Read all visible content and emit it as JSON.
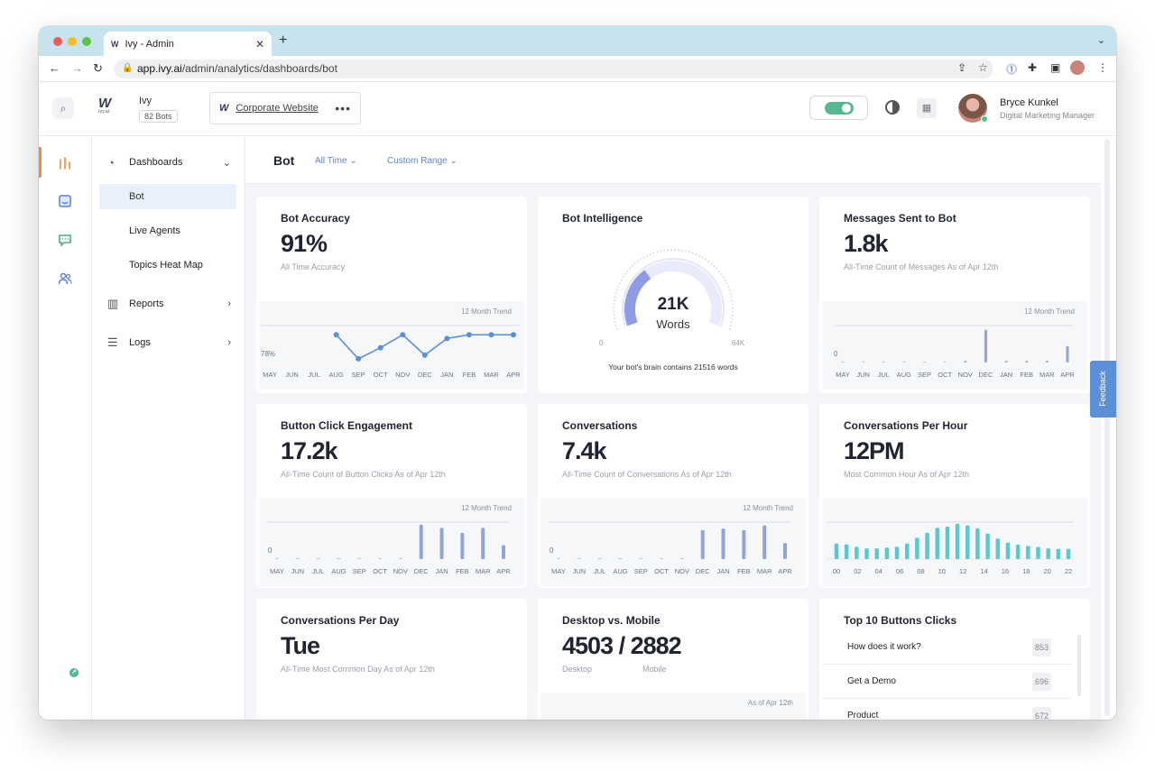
{
  "browser": {
    "tab_title": "Ivy - Admin",
    "favicon": "W",
    "new_tab": "+",
    "url_host": "app.ivy.ai",
    "url_path": "/admin/analytics/dashboards/bot"
  },
  "header": {
    "logo": "W",
    "logo_sub": "ivy.ai",
    "bot_name": "Ivy",
    "bot_count": "82 Bots",
    "site_name": "Corporate Website",
    "site_menu": "•••",
    "user_name": "Bryce Kunkel",
    "user_role": "Digital Marketing Manager"
  },
  "sidebar": {
    "items": [
      {
        "label": "Dashboards",
        "icon": "pie-chart-icon"
      },
      {
        "label": "Bot"
      },
      {
        "label": "Live Agents"
      },
      {
        "label": "Topics Heat Map"
      },
      {
        "label": "Reports",
        "icon": "bar-chart-icon"
      },
      {
        "label": "Logs",
        "icon": "list-icon"
      }
    ]
  },
  "page": {
    "title": "Bot",
    "filter_time": "All Time",
    "filter_range": "Custom Range"
  },
  "feedback": "Feedback",
  "cards": {
    "accuracy": {
      "title": "Bot Accuracy",
      "value": "91%",
      "subtitle": "All Time Accuracy",
      "trend_label": "12 Month Trend",
      "y_label": "78%"
    },
    "intelligence": {
      "title": "Bot Intelligence",
      "value": "21K",
      "unit": "Words",
      "min": "0",
      "max": "64K",
      "caption": "Your bot's brain contains 21516 words"
    },
    "messages": {
      "title": "Messages Sent to Bot",
      "value": "1.8k",
      "subtitle": "All-Time Count of Messages As of Apr 12th",
      "trend_label": "12 Month Trend",
      "y_label": "0"
    },
    "buttons": {
      "title": "Button Click Engagement",
      "value": "17.2k",
      "subtitle": "All-Time Count of Button Clicks As of Apr 12th",
      "trend_label": "12 Month Trend",
      "y_label": "0"
    },
    "conversations": {
      "title": "Conversations",
      "value": "7.4k",
      "subtitle": "All-Time Count of Conversations As of Apr 12th",
      "trend_label": "12 Month Trend",
      "y_label": "0"
    },
    "per_hour": {
      "title": "Conversations Per Hour",
      "value": "12PM",
      "subtitle": "Most Common Hour As of Apr 12th"
    },
    "per_day": {
      "title": "Conversations Per Day",
      "value": "Tue",
      "subtitle": "All-Time Most Common Day As of Apr 12th"
    },
    "desktop_mobile": {
      "title": "Desktop vs. Mobile",
      "value": "4503 / 2882",
      "desktop_label": "Desktop",
      "mobile_label": "Mobile",
      "as_of": "As of Apr 12th"
    },
    "top_buttons": {
      "title": "Top 10 Buttons Clicks",
      "rows": [
        {
          "label": "How does it work?",
          "count": "853"
        },
        {
          "label": "Get a Demo",
          "count": "696"
        },
        {
          "label": "Product",
          "count": "672"
        }
      ]
    }
  },
  "chart_data": [
    {
      "id": "accuracy",
      "type": "line",
      "categories": [
        "MAY",
        "JUN",
        "JUL",
        "AUG",
        "SEP",
        "OCT",
        "NOV",
        "DEC",
        "JAN",
        "FEB",
        "MAR",
        "APR"
      ],
      "values": [
        null,
        null,
        null,
        91,
        78,
        84,
        91,
        80,
        89,
        91,
        91,
        91
      ],
      "ylim": [
        76,
        96
      ],
      "color": "#5b8fd6"
    },
    {
      "id": "messages",
      "type": "bar",
      "categories": [
        "MAY",
        "JUN",
        "JUL",
        "AUG",
        "SEP",
        "OCT",
        "NOV",
        "DEC",
        "JAN",
        "FEB",
        "MAR",
        "APR"
      ],
      "values": [
        0,
        0,
        0,
        0,
        0,
        0,
        20,
        400,
        20,
        20,
        20,
        200
      ],
      "ylim": [
        0,
        450
      ],
      "color": "#8fa4dd"
    },
    {
      "id": "buttons",
      "type": "bar",
      "categories": [
        "MAY",
        "JUN",
        "JUL",
        "AUG",
        "SEP",
        "OCT",
        "NOV",
        "DEC",
        "JAN",
        "FEB",
        "MAR",
        "APR"
      ],
      "values": [
        0,
        0,
        0,
        0,
        20,
        0,
        0,
        4200,
        3800,
        3200,
        3800,
        1700
      ],
      "ylim": [
        0,
        4500
      ],
      "color": "#8fa4dd"
    },
    {
      "id": "conversations",
      "type": "bar",
      "categories": [
        "MAY",
        "JUN",
        "JUL",
        "AUG",
        "SEP",
        "OCT",
        "NOV",
        "DEC",
        "JAN",
        "FEB",
        "MAR",
        "APR"
      ],
      "values": [
        0,
        0,
        0,
        0,
        0,
        0,
        0,
        1800,
        1900,
        1800,
        2100,
        1000
      ],
      "ylim": [
        0,
        2300
      ],
      "color": "#8fa4dd"
    },
    {
      "id": "per_hour",
      "type": "bar",
      "categories": [
        "00",
        "01",
        "02",
        "03",
        "04",
        "05",
        "06",
        "07",
        "08",
        "09",
        "10",
        "11",
        "12",
        "13",
        "14",
        "15",
        "16",
        "17",
        "18",
        "19",
        "20",
        "21",
        "22",
        "23"
      ],
      "tick_labels": [
        "00",
        "02",
        "04",
        "06",
        "08",
        "10",
        "12",
        "14",
        "16",
        "18",
        "20",
        "22"
      ],
      "values": [
        380,
        360,
        300,
        260,
        260,
        280,
        300,
        380,
        520,
        640,
        760,
        790,
        860,
        820,
        750,
        620,
        500,
        400,
        350,
        320,
        300,
        260,
        250,
        250
      ],
      "ylim": [
        0,
        900
      ],
      "color": "#5ac8cf"
    },
    {
      "id": "intelligence",
      "type": "gauge",
      "value": 21516,
      "range": [
        0,
        64000
      ],
      "color": "#8f9ce5"
    }
  ]
}
